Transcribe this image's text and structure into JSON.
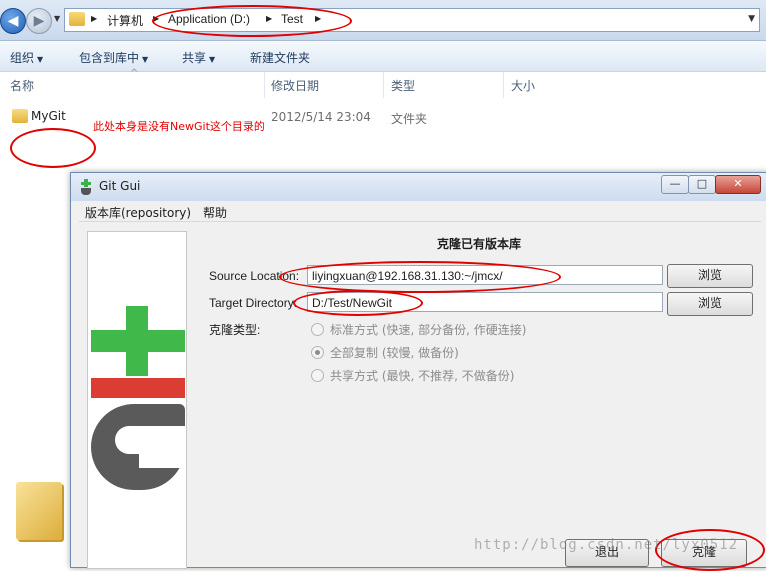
{
  "explorer": {
    "breadcrumbs": [
      "计算机",
      "Application (D:)",
      "Test"
    ],
    "toolbar": {
      "organize": "组织",
      "include_in_library": "包含到库中",
      "share": "共享",
      "new_folder": "新建文件夹"
    },
    "columns": [
      "名称",
      "修改日期",
      "类型",
      "大小"
    ],
    "files": [
      {
        "name": "MyGit",
        "date": "2012/5/14 23:04",
        "type": "文件夹"
      }
    ],
    "annotation": "此处本身是没有NewGit这个目录的"
  },
  "git_gui": {
    "title": "Git Gui",
    "menu": [
      "版本库(repository)",
      "帮助"
    ],
    "form_title": "克隆已有版本库",
    "source_label": "Source Location:",
    "source_value": "liyingxuan@192.168.31.130:~/jmcx/",
    "target_label": "Target Directory:",
    "target_value": "D:/Test/NewGit",
    "browse_label": "浏览",
    "clone_type_label": "克隆类型:",
    "clone_options": [
      {
        "label": "标准方式 (快速, 部分备份, 作硬连接)",
        "selected": false
      },
      {
        "label": "全部复制 (较慢, 做备份)",
        "selected": true
      },
      {
        "label": "共享方式 (最快, 不推荐, 不做备份)",
        "selected": false
      }
    ],
    "quit_label": "退出",
    "clone_label": "克隆"
  },
  "watermark": "http://blog.csdn.net/lyx0512",
  "colors": {
    "annotation_red": "#e00000",
    "git_green": "#40b94a",
    "git_red": "#dc3d32",
    "git_gray": "#5a5a5a"
  },
  "icons": [
    "back-arrow-icon",
    "forward-arrow-icon",
    "folder-icon",
    "git-logo-icon",
    "radio-icon"
  ]
}
